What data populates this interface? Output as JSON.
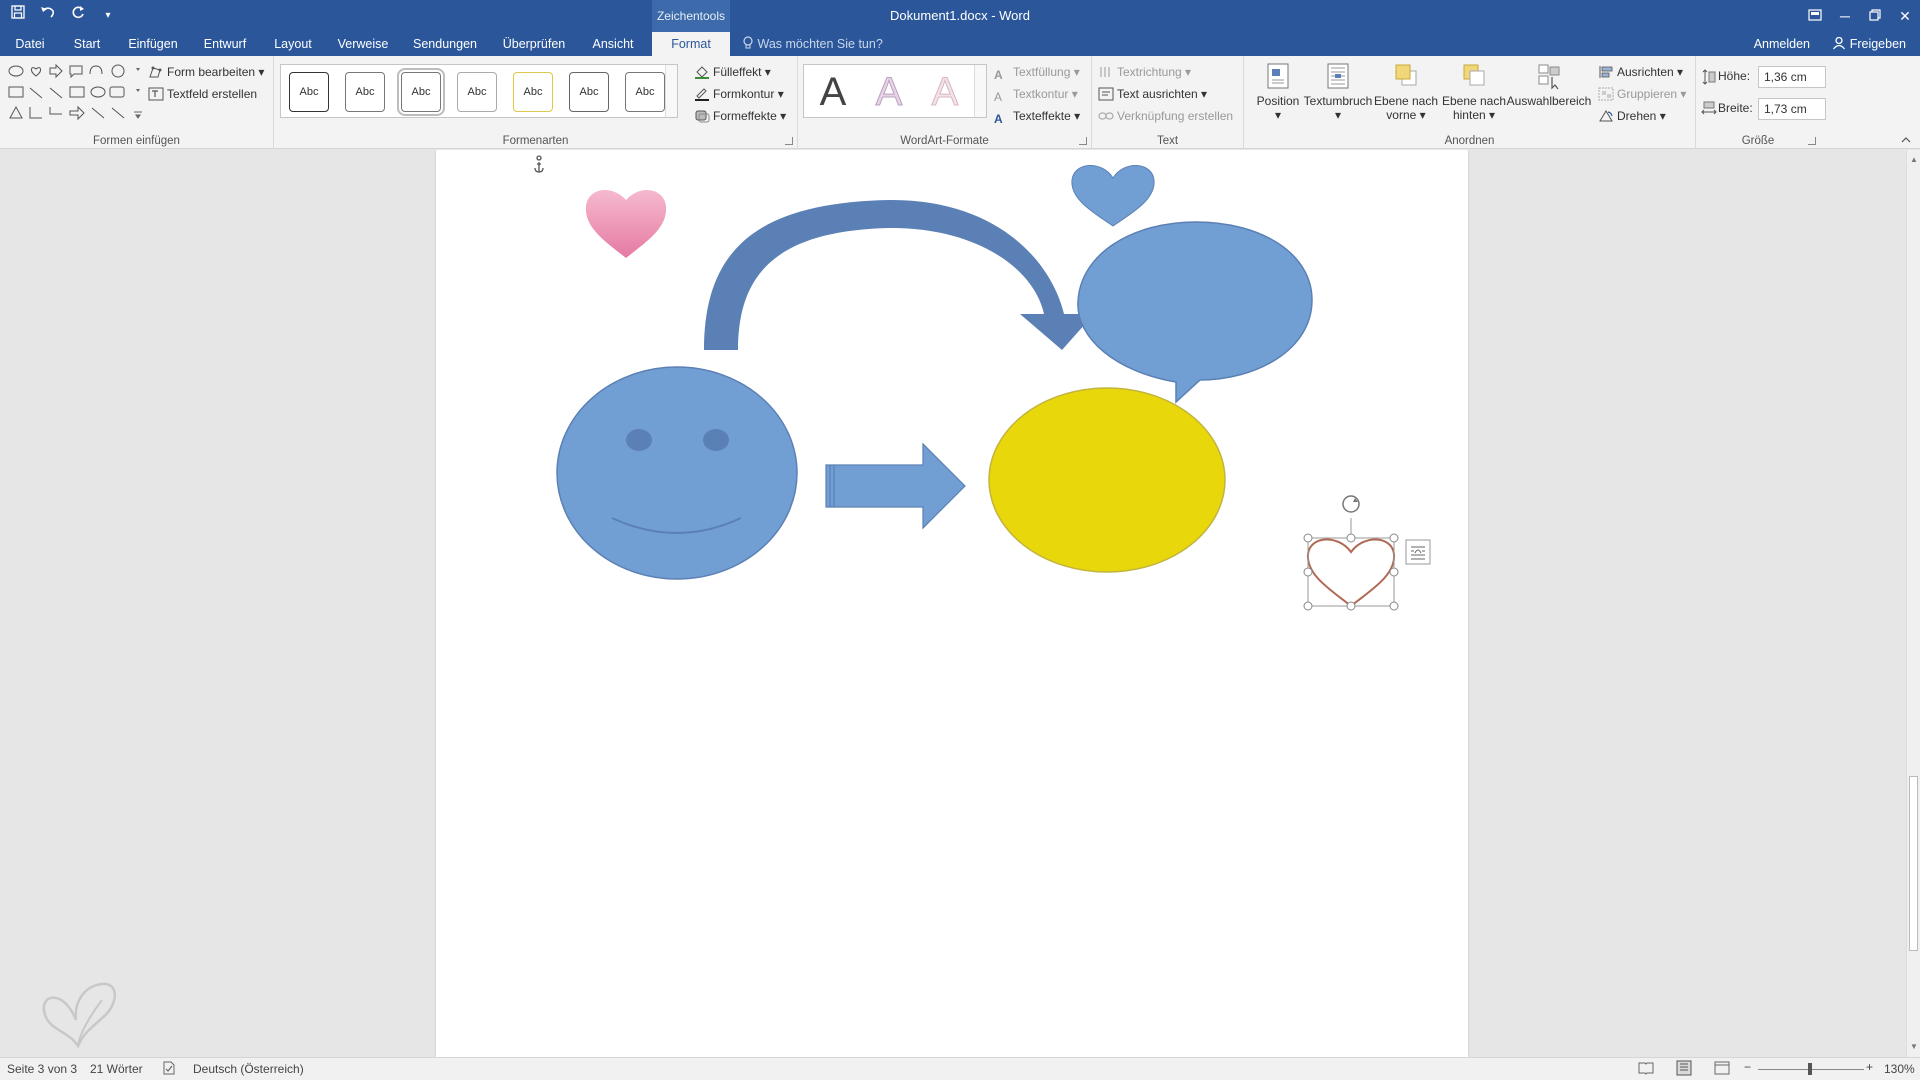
{
  "window": {
    "context_tab_label": "Zeichentools",
    "title": "Dokument1.docx - Word"
  },
  "tabs": [
    {
      "label": "Datei"
    },
    {
      "label": "Start"
    },
    {
      "label": "Einfügen"
    },
    {
      "label": "Entwurf"
    },
    {
      "label": "Layout"
    },
    {
      "label": "Verweise"
    },
    {
      "label": "Sendungen"
    },
    {
      "label": "Überprüfen"
    },
    {
      "label": "Ansicht"
    },
    {
      "label": "Format"
    }
  ],
  "active_tab": "Format",
  "tell_me": "Was möchten Sie tun?",
  "account": {
    "signin": "Anmelden",
    "share": "Freigeben"
  },
  "ribbon": {
    "formen_einfuegen": {
      "label": "Formen einfügen",
      "form_bearbeiten": "Form bearbeiten",
      "textfeld_erstellen": "Textfeld erstellen"
    },
    "formenarten": {
      "label": "Formenarten",
      "styles": [
        "Abc",
        "Abc",
        "Abc",
        "Abc",
        "Abc",
        "Abc",
        "Abc"
      ],
      "fuelleffekt": "Fülleffekt",
      "formkontur": "Formkontur",
      "formeffekte": "Formeffekte"
    },
    "wordart": {
      "label": "WordArt-Formate",
      "letters": [
        "A",
        "A",
        "A"
      ],
      "textfuellung": "Textfüllung",
      "textkontur": "Textkontur",
      "texteffekte": "Texteffekte"
    },
    "text": {
      "label": "Text",
      "textrichtung": "Textrichtung",
      "text_ausrichten": "Text ausrichten",
      "verknuepfung": "Verknüpfung erstellen"
    },
    "anordnen": {
      "label": "Anordnen",
      "position": "Position",
      "textumbruch": "Textumbruch",
      "ebene_vorne_1": "Ebene nach",
      "ebene_vorne_2": "vorne",
      "ebene_hinten_1": "Ebene nach",
      "ebene_hinten_2": "hinten",
      "auswahlbereich": "Auswahlbereich",
      "ausrichten": "Ausrichten",
      "gruppieren": "Gruppieren",
      "drehen": "Drehen"
    },
    "groesse": {
      "label": "Größe",
      "hoehe_label": "Höhe:",
      "hoehe_value": "1,36 cm",
      "breite_label": "Breite:",
      "breite_value": "1,73 cm"
    }
  },
  "colors": {
    "accent": "#2b579a",
    "shape_blue": "#729fd3",
    "shape_blue_dark": "#5b80b5",
    "yellow": "#e8d70a",
    "pink": "#e98fb0",
    "heart_outline": "#b06a54"
  },
  "statusbar": {
    "page": "Seite 3 von 3",
    "words": "21 Wörter",
    "language": "Deutsch (Österreich)",
    "zoom": "130%"
  }
}
